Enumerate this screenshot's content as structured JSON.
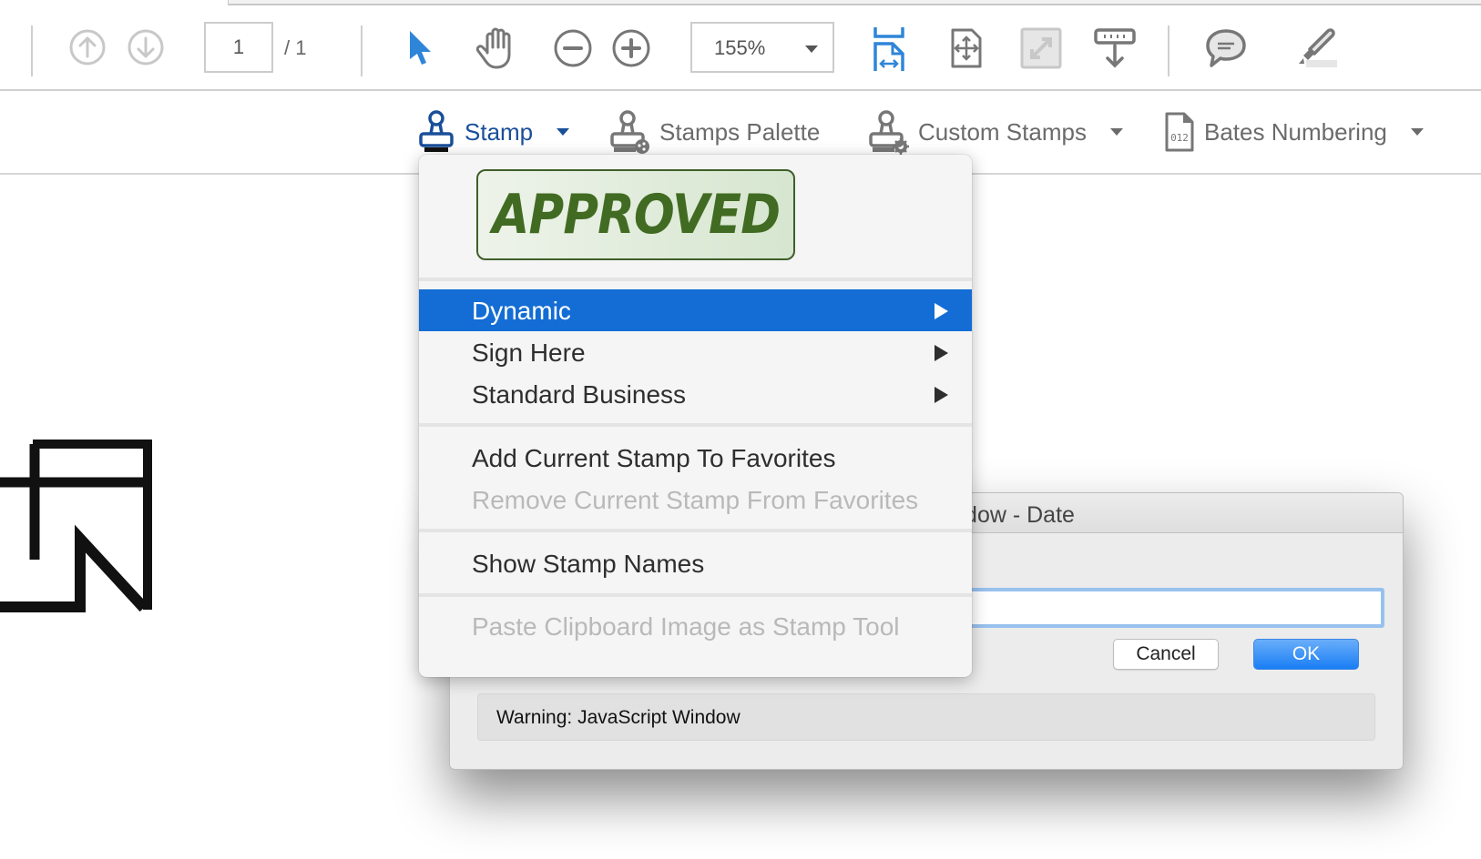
{
  "toolbar": {
    "page_current": "1",
    "page_total": "/  1",
    "zoom_value": "155%",
    "icons": [
      "prev-page-icon",
      "next-page-icon",
      "select-arrow-icon",
      "hand-tool-icon",
      "zoom-out-icon",
      "zoom-in-icon",
      "fit-width-icon",
      "fit-page-icon",
      "full-screen-icon",
      "scroll-mode-icon",
      "comment-icon",
      "highlight-icon"
    ]
  },
  "stamp_bar": {
    "stamp_label": "Stamp",
    "palette_label": "Stamps Palette",
    "custom_label": "Custom Stamps",
    "bates_label": "Bates Numbering"
  },
  "menu": {
    "preview_text": "APPROVED",
    "items": [
      {
        "label": "Dynamic",
        "submenu": true,
        "state": "highlighted"
      },
      {
        "label": "Sign Here",
        "submenu": true,
        "state": "enabled"
      },
      {
        "label": "Standard Business",
        "submenu": true,
        "state": "enabled"
      },
      {
        "label": "Add Current Stamp To Favorites",
        "state": "enabled"
      },
      {
        "label": "Remove Current Stamp From Favorites",
        "state": "disabled"
      },
      {
        "label": "Show Stamp Names",
        "state": "enabled"
      },
      {
        "label": "Paste Clipboard Image as Stamp Tool",
        "state": "disabled"
      }
    ]
  },
  "dialog": {
    "title": "Window - Date",
    "input_value": "",
    "cancel_label": "Cancel",
    "ok_label": "OK",
    "warning": "Warning: JavaScript Window"
  },
  "colors": {
    "accent_blue": "#136dd5",
    "stamp_active": "#1a4f99",
    "approved_green": "#416b22",
    "ok_button": "#1a7ef5"
  }
}
